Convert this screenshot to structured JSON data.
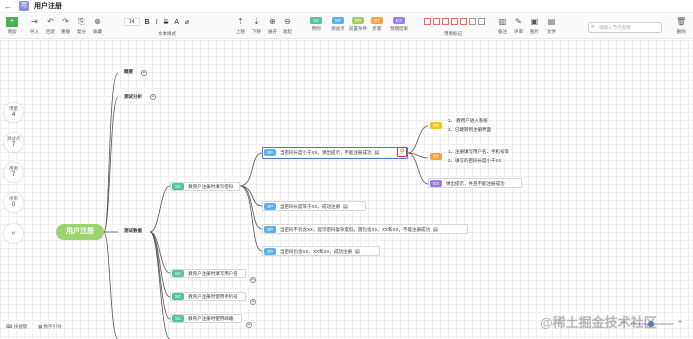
{
  "app": {
    "title": "用户注册",
    "logo": "用"
  },
  "toolbar": {
    "tools": [
      {
        "icon": "+",
        "label": "增加"
      },
      {
        "icon": "⇥",
        "label": "导入"
      },
      {
        "icon": "↶",
        "label": "回退"
      },
      {
        "icon": "↷",
        "label": "重做"
      },
      {
        "icon": "⎘",
        "label": "复分"
      },
      {
        "icon": "⊗",
        "label": "收藏"
      }
    ],
    "font_size": "14",
    "font_label": "文本样式",
    "tools2": [
      {
        "icon": "⇡",
        "label": "上移"
      },
      {
        "icon": "⇣",
        "label": "下移"
      },
      {
        "icon": "⊕",
        "label": "展开"
      },
      {
        "icon": "⊖",
        "label": "收起"
      }
    ],
    "tags": [
      {
        "text": "SC",
        "label": "用例",
        "color": "#52c49c"
      },
      {
        "text": "SP",
        "label": "测试点",
        "color": "#5ab1ef"
      },
      {
        "text": "PR",
        "label": "前置条件",
        "color": "#9fd15c"
      },
      {
        "text": "ST",
        "label": "步骤",
        "color": "#f5a43c"
      },
      {
        "text": "EX",
        "label": "预期结果",
        "color": "#9b7fe0"
      }
    ],
    "mark_label": "用例标记",
    "tools3": [
      {
        "icon": "▥",
        "label": "备注"
      },
      {
        "icon": "✎",
        "label": "评审"
      },
      {
        "icon": "▣",
        "label": "图片"
      },
      {
        "icon": "▤",
        "label": "文件"
      }
    ],
    "search_placeholder": "请输入节点名称",
    "delete_label": "删除"
  },
  "sidebar": [
    {
      "label": "用量",
      "value": "4"
    },
    {
      "label": "测试点",
      "value": "7"
    },
    {
      "label": "用例",
      "value": "7"
    },
    {
      "label": "评审",
      "value": "0"
    }
  ],
  "sidebar_collapse": "«",
  "mindmap": {
    "root": "用户注册",
    "l1": [
      "概要",
      "测试分析",
      "测试数据"
    ],
    "l2": [
      "教育户注册时填写密码",
      "教育户注册时填写用户名",
      "教育户注册时使用手机号",
      "教育户注册时使用邮箱"
    ],
    "sp_tag": "SP",
    "sc_tag": "SC",
    "pr_tag": "PR",
    "st_tag": "ST",
    "ex_tag": "EX",
    "l3": [
      "当密码长度小于XX，弹出提示，不能注册成功",
      "当密码长度等于XX，成功注册",
      "当密码不包含XX，提示密码复杂度低，需包含XX、XX和XX，不能注册成功",
      "当密码包含XX、XX和XX，成功注册"
    ],
    "pr_text": [
      "1、 教用户进入系统",
      "2、已跳转到注册界面"
    ],
    "st_text": [
      "1、注册填写用户名、手机号等",
      "2、填写的密码长度小于XX"
    ],
    "ex_text": "弹出提示，并且不能注册成功"
  },
  "bottom": {
    "left1": "快捷键",
    "left2": "数字引导",
    "zoom_minus": "—",
    "zoom_plus": "+"
  },
  "watermark": "@稀土掘金技术社区"
}
